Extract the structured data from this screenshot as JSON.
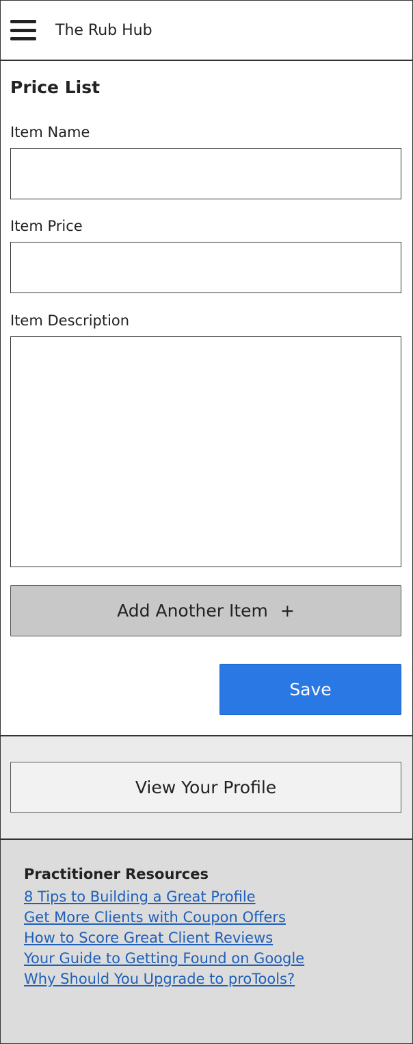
{
  "header": {
    "menu_icon": "hamburger-menu-icon",
    "app_title": "The Rub Hub"
  },
  "price_list": {
    "title": "Price List",
    "item_name": {
      "label": "Item Name",
      "value": ""
    },
    "item_price": {
      "label": "Item Price",
      "value": ""
    },
    "item_description": {
      "label": "Item Description",
      "value": ""
    },
    "add_button": {
      "label": "Add Another Item",
      "icon": "+"
    },
    "save_button": {
      "label": "Save"
    }
  },
  "profile": {
    "view_button": "View Your Profile"
  },
  "resources": {
    "title": "Practitioner Resources",
    "links": [
      "8 Tips to Building a Great Profile",
      "Get More Clients with Coupon Offers",
      "How to Score Great Client Reviews",
      "Your Guide to Getting Found on Google",
      "Why Should You Upgrade to proTools?"
    ]
  },
  "colors": {
    "save_button": "#2a78e4",
    "add_button": "#c8c8c8",
    "link": "#1f5fb8",
    "resources_bg": "#dcdcdc",
    "profile_band_bg": "#ebebeb"
  }
}
